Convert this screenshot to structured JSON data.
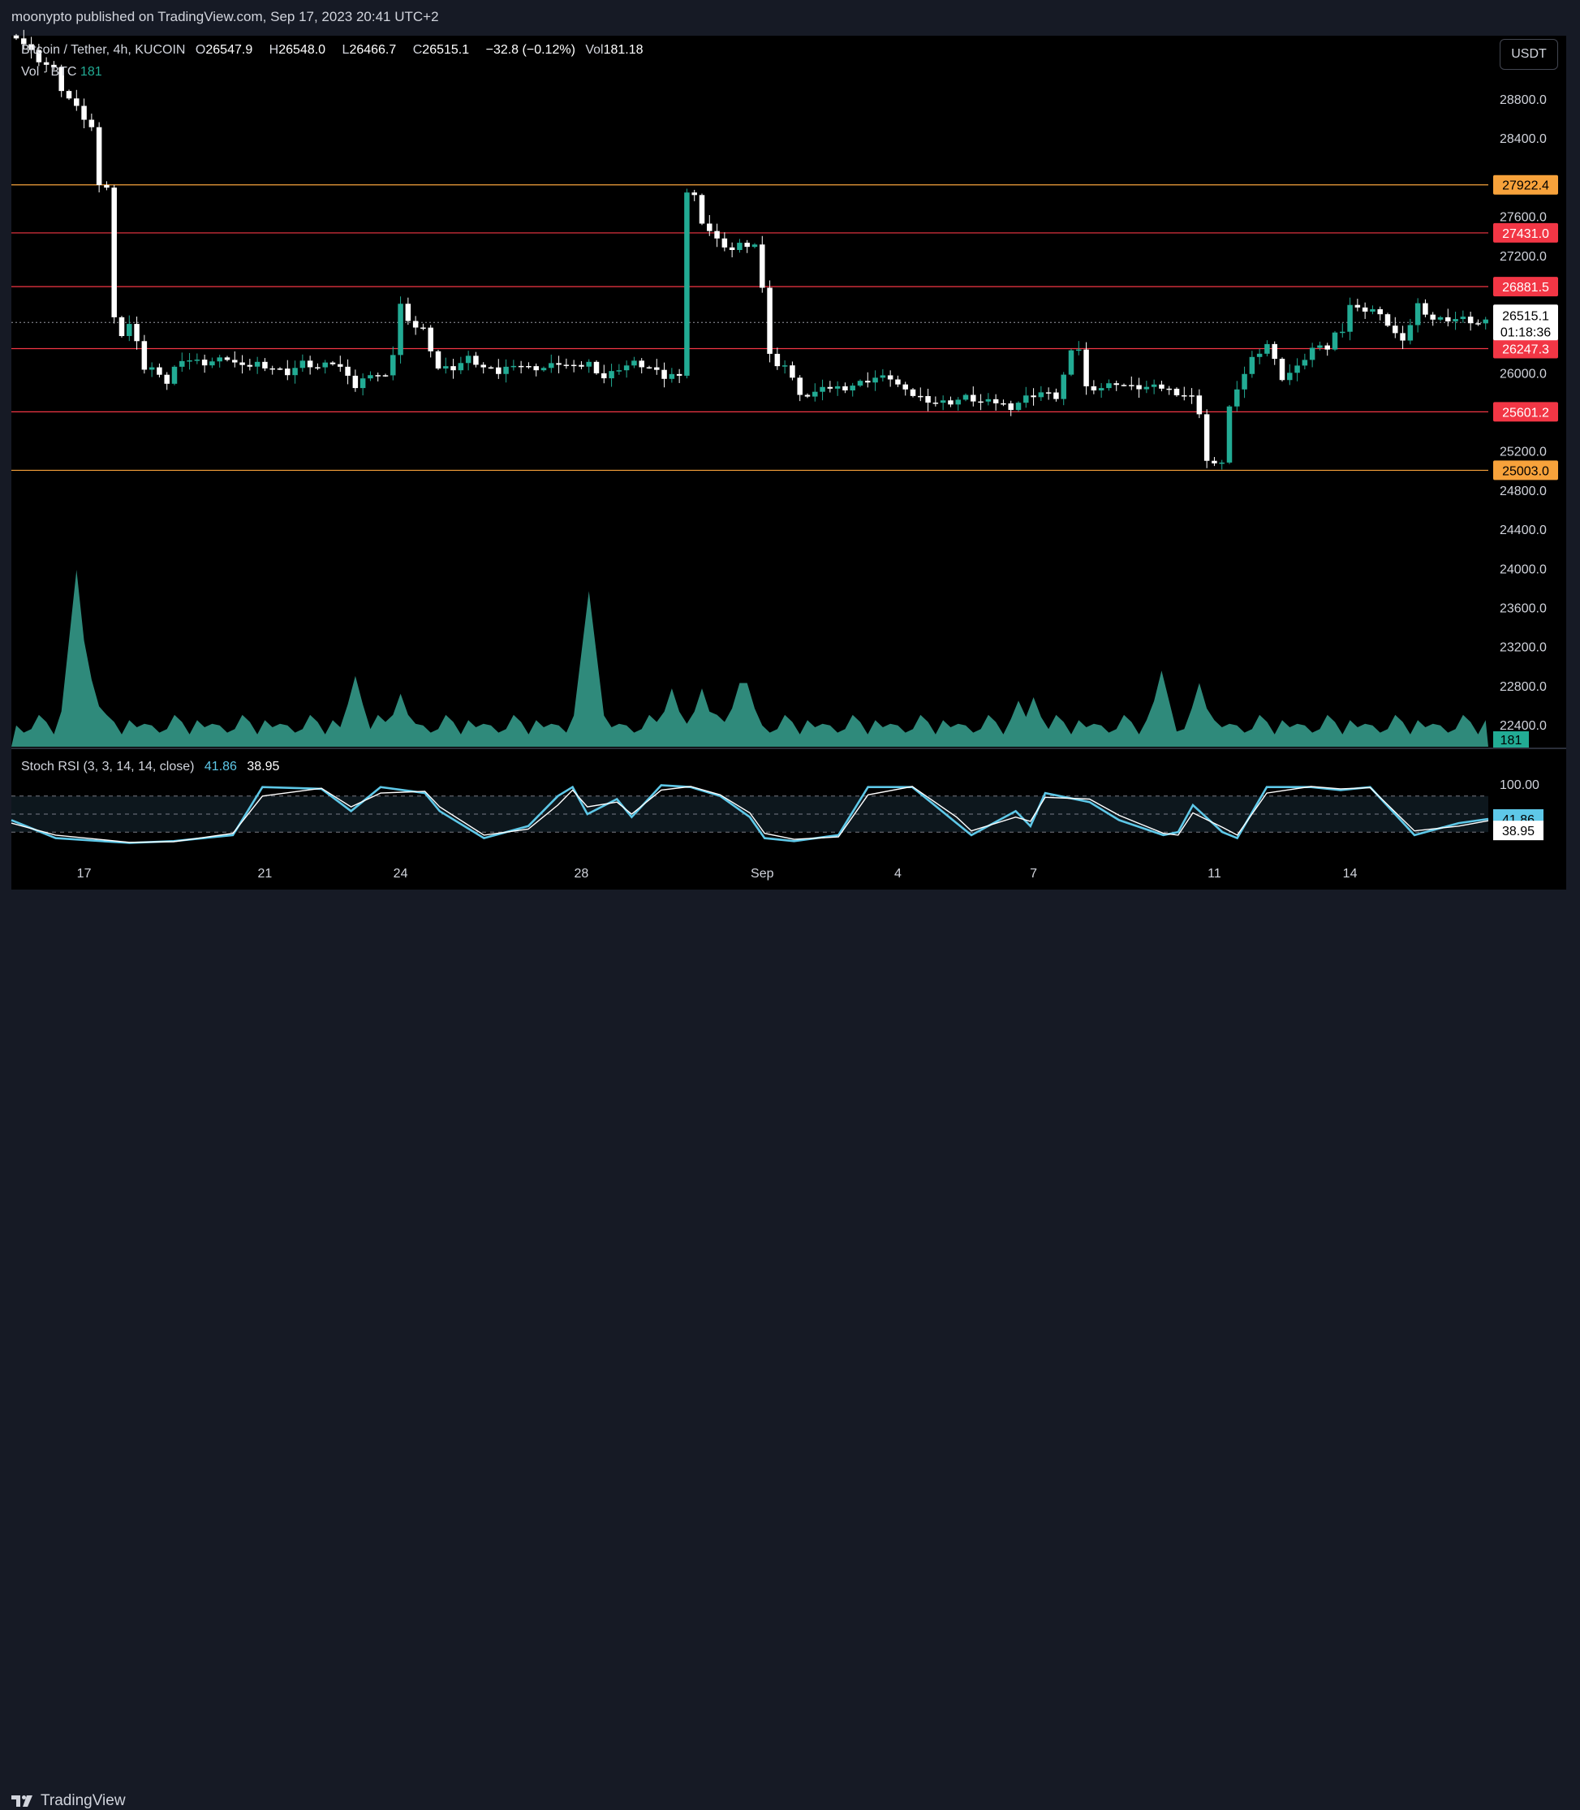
{
  "header": {
    "publisher_line": "moonypto published on TradingView.com, Sep 17, 2023 20:41 UTC+2"
  },
  "legend": {
    "symbol": "Bitcoin / Tether, 4h, KUCOIN",
    "open_label": "O",
    "open": "26547.9",
    "high_label": "H",
    "high": "26548.0",
    "low_label": "L",
    "low": "26466.7",
    "close_label": "C",
    "close": "26515.1",
    "change": "−32.8 (−0.12%)",
    "vol_label": "Vol",
    "vol": "181.18"
  },
  "volume_legend": {
    "label": "Vol · BTC",
    "value": "181"
  },
  "stoch_legend": {
    "label": "Stoch RSI (3, 3, 14, 14, close)",
    "k": "41.86",
    "d": "38.95"
  },
  "currency_button": "USDT",
  "footer": {
    "brand": "TradingView"
  },
  "colors": {
    "up": "#22ab94",
    "down": "#ffffff",
    "orange_level": "#f7a23b",
    "red_level": "#f23645",
    "volume": "#3fb8a4",
    "stoch_k": "#5ec8e8",
    "stoch_d": "#ffffff",
    "background": "#000000"
  },
  "chart_data": {
    "type": "candlestick",
    "symbol": "Bitcoin / Tether, 4h, KUCOIN",
    "price_axis_ticks": [
      "28800.0",
      "28400.0",
      "27600.0",
      "27200.0",
      "26000.0",
      "25200.0",
      "24800.0",
      "24400.0",
      "24000.0",
      "23600.0",
      "23200.0",
      "22800.0",
      "22400.0"
    ],
    "time_axis_labels": [
      {
        "label": "17",
        "bar": 9
      },
      {
        "label": "21",
        "bar": 33
      },
      {
        "label": "24",
        "bar": 51
      },
      {
        "label": "28",
        "bar": 75
      },
      {
        "label": "Sep",
        "bar": 99
      },
      {
        "label": "4",
        "bar": 117
      },
      {
        "label": "7",
        "bar": 135
      },
      {
        "label": "11",
        "bar": 159
      },
      {
        "label": "14",
        "bar": 177
      }
    ],
    "last_price": "26515.1",
    "countdown": "01:18:36",
    "volume_last": "181",
    "horizontal_levels": [
      {
        "value": 27922.4,
        "label": "27922.4",
        "color": "orange"
      },
      {
        "value": 27431.0,
        "label": "27431.0",
        "color": "red"
      },
      {
        "value": 26881.5,
        "label": "26881.5",
        "color": "red"
      },
      {
        "value": 26247.3,
        "label": "26247.3",
        "color": "red"
      },
      {
        "value": 25601.2,
        "label": "25601.2",
        "color": "red"
      },
      {
        "value": 25003.0,
        "label": "25003.0",
        "color": "orange"
      }
    ],
    "close_path": [
      [
        0,
        29450
      ],
      [
        3,
        29200
      ],
      [
        5,
        29100
      ],
      [
        6,
        28900
      ],
      [
        8,
        28700
      ],
      [
        9,
        28600
      ],
      [
        10,
        28500
      ],
      [
        11,
        27950
      ],
      [
        12,
        27900
      ],
      [
        13,
        26550
      ],
      [
        14,
        26400
      ],
      [
        15,
        26500
      ],
      [
        16,
        26300
      ],
      [
        17,
        26050
      ],
      [
        18,
        26050
      ],
      [
        19,
        25950
      ],
      [
        20,
        25900
      ],
      [
        21,
        26050
      ],
      [
        22,
        26150
      ],
      [
        25,
        26100
      ],
      [
        28,
        26150
      ],
      [
        30,
        26050
      ],
      [
        32,
        26100
      ],
      [
        34,
        26050
      ],
      [
        36,
        26000
      ],
      [
        38,
        26100
      ],
      [
        40,
        26050
      ],
      [
        42,
        26100
      ],
      [
        44,
        26000
      ],
      [
        45,
        25850
      ],
      [
        47,
        26000
      ],
      [
        49,
        25950
      ],
      [
        50,
        26200
      ],
      [
        51,
        26700
      ],
      [
        52,
        26500
      ],
      [
        54,
        26450
      ],
      [
        56,
        26050
      ],
      [
        58,
        26050
      ],
      [
        60,
        26150
      ],
      [
        62,
        26050
      ],
      [
        64,
        26000
      ],
      [
        66,
        26100
      ],
      [
        68,
        26050
      ],
      [
        70,
        26050
      ],
      [
        72,
        26100
      ],
      [
        74,
        26050
      ],
      [
        76,
        26100
      ],
      [
        78,
        25950
      ],
      [
        80,
        26050
      ],
      [
        82,
        26100
      ],
      [
        84,
        26050
      ],
      [
        86,
        25950
      ],
      [
        88,
        26000
      ],
      [
        89,
        27850
      ],
      [
        90,
        27800
      ],
      [
        91,
        27550
      ],
      [
        92,
        27450
      ],
      [
        93,
        27350
      ],
      [
        94,
        27300
      ],
      [
        95,
        27250
      ],
      [
        96,
        27300
      ],
      [
        98,
        27300
      ],
      [
        99,
        26900
      ],
      [
        100,
        26200
      ],
      [
        101,
        26050
      ],
      [
        102,
        26100
      ],
      [
        103,
        25950
      ],
      [
        104,
        25750
      ],
      [
        106,
        25800
      ],
      [
        108,
        25850
      ],
      [
        110,
        25850
      ],
      [
        112,
        25900
      ],
      [
        114,
        25950
      ],
      [
        116,
        25950
      ],
      [
        118,
        25800
      ],
      [
        120,
        25750
      ],
      [
        122,
        25700
      ],
      [
        124,
        25700
      ],
      [
        126,
        25750
      ],
      [
        128,
        25700
      ],
      [
        130,
        25700
      ],
      [
        132,
        25650
      ],
      [
        134,
        25750
      ],
      [
        136,
        25800
      ],
      [
        138,
        25750
      ],
      [
        140,
        26200
      ],
      [
        141,
        26250
      ],
      [
        142,
        25850
      ],
      [
        144,
        25850
      ],
      [
        146,
        25900
      ],
      [
        148,
        25850
      ],
      [
        150,
        25850
      ],
      [
        152,
        25850
      ],
      [
        154,
        25800
      ],
      [
        156,
        25750
      ],
      [
        157,
        25600
      ],
      [
        158,
        25100
      ],
      [
        159,
        25050
      ],
      [
        160,
        25100
      ],
      [
        161,
        25650
      ],
      [
        162,
        25800
      ],
      [
        163,
        26000
      ],
      [
        164,
        26150
      ],
      [
        166,
        26300
      ],
      [
        168,
        25950
      ],
      [
        170,
        26050
      ],
      [
        172,
        26250
      ],
      [
        174,
        26250
      ],
      [
        175,
        26400
      ],
      [
        176,
        26450
      ],
      [
        177,
        26700
      ],
      [
        178,
        26650
      ],
      [
        180,
        26650
      ],
      [
        182,
        26500
      ],
      [
        184,
        26300
      ],
      [
        186,
        26700
      ],
      [
        188,
        26550
      ],
      [
        190,
        26550
      ],
      [
        192,
        26550
      ],
      [
        194,
        26500
      ],
      [
        195,
        26515
      ]
    ],
    "volume_peaks": [
      [
        8,
        1.0
      ],
      [
        10,
        0.38
      ],
      [
        45,
        0.4
      ],
      [
        51,
        0.3
      ],
      [
        76,
        0.88
      ],
      [
        87,
        0.33
      ],
      [
        91,
        0.33
      ],
      [
        96,
        0.36
      ],
      [
        97,
        0.36
      ],
      [
        133,
        0.26
      ],
      [
        135,
        0.28
      ],
      [
        152,
        0.43
      ],
      [
        157,
        0.36
      ]
    ],
    "stoch_rsi": {
      "k_last": 41.86,
      "d_last": 38.95,
      "upper_band": 80,
      "lower_band": 20,
      "axis_top_label": "100.00",
      "k": [
        [
          0,
          40
        ],
        [
          6,
          10
        ],
        [
          16,
          2
        ],
        [
          22,
          5
        ],
        [
          30,
          15
        ],
        [
          34,
          95
        ],
        [
          42,
          92
        ],
        [
          46,
          55
        ],
        [
          50,
          95
        ],
        [
          56,
          85
        ],
        [
          58,
          55
        ],
        [
          64,
          10
        ],
        [
          70,
          30
        ],
        [
          74,
          80
        ],
        [
          76,
          95
        ],
        [
          78,
          50
        ],
        [
          82,
          75
        ],
        [
          84,
          45
        ],
        [
          88,
          98
        ],
        [
          92,
          95
        ],
        [
          96,
          80
        ],
        [
          100,
          45
        ],
        [
          102,
          10
        ],
        [
          106,
          5
        ],
        [
          112,
          15
        ],
        [
          116,
          95
        ],
        [
          122,
          95
        ],
        [
          128,
          35
        ],
        [
          130,
          15
        ],
        [
          136,
          55
        ],
        [
          138,
          30
        ],
        [
          140,
          85
        ],
        [
          146,
          70
        ],
        [
          150,
          40
        ],
        [
          156,
          15
        ],
        [
          158,
          20
        ],
        [
          160,
          65
        ],
        [
          164,
          20
        ],
        [
          166,
          10
        ],
        [
          170,
          95
        ],
        [
          176,
          95
        ],
        [
          180,
          90
        ],
        [
          184,
          95
        ],
        [
          190,
          15
        ],
        [
          196,
          35
        ],
        [
          200,
          41.86
        ]
      ],
      "d": [
        [
          0,
          35
        ],
        [
          6,
          15
        ],
        [
          16,
          3
        ],
        [
          22,
          4
        ],
        [
          30,
          18
        ],
        [
          34,
          80
        ],
        [
          42,
          93
        ],
        [
          46,
          62
        ],
        [
          50,
          85
        ],
        [
          56,
          88
        ],
        [
          58,
          62
        ],
        [
          64,
          15
        ],
        [
          70,
          25
        ],
        [
          74,
          65
        ],
        [
          76,
          90
        ],
        [
          78,
          62
        ],
        [
          82,
          70
        ],
        [
          84,
          50
        ],
        [
          88,
          90
        ],
        [
          92,
          96
        ],
        [
          96,
          82
        ],
        [
          100,
          52
        ],
        [
          102,
          18
        ],
        [
          106,
          8
        ],
        [
          112,
          12
        ],
        [
          116,
          82
        ],
        [
          122,
          96
        ],
        [
          128,
          45
        ],
        [
          130,
          22
        ],
        [
          136,
          45
        ],
        [
          138,
          38
        ],
        [
          140,
          78
        ],
        [
          146,
          75
        ],
        [
          150,
          48
        ],
        [
          156,
          18
        ],
        [
          158,
          15
        ],
        [
          160,
          52
        ],
        [
          164,
          28
        ],
        [
          166,
          15
        ],
        [
          170,
          85
        ],
        [
          176,
          96
        ],
        [
          180,
          92
        ],
        [
          184,
          94
        ],
        [
          190,
          22
        ],
        [
          196,
          30
        ],
        [
          200,
          38.95
        ]
      ]
    }
  }
}
